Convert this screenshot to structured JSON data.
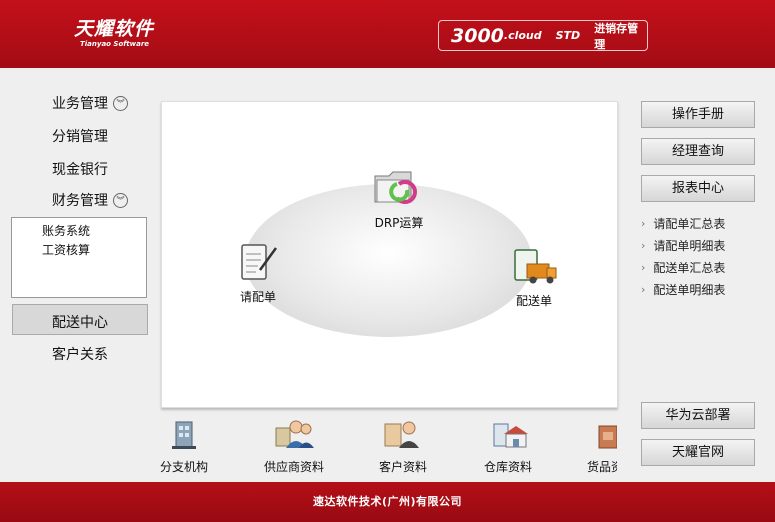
{
  "header": {
    "logo_cn": "天耀软件",
    "logo_en": "Tianyao Software",
    "product_number": "3000",
    "product_cloud": ".cloud",
    "product_edition": "STD",
    "product_name": "进销存管理",
    "bg_color": "#b50f18"
  },
  "nav": {
    "items": [
      {
        "label": "业务管理",
        "icon": "double-chevron-down-icon"
      },
      {
        "label": "分销管理"
      },
      {
        "label": "现金银行"
      },
      {
        "label": "财务管理",
        "icon": "double-chevron-down-icon"
      },
      {
        "label": "配送中心",
        "active": true
      },
      {
        "label": "客户关系"
      }
    ],
    "sub_items": [
      "账务系统",
      "工资核算"
    ]
  },
  "flow": {
    "drp": {
      "label": "DRP运算",
      "icon": "folder-sync-icon"
    },
    "request": {
      "label": "请配单",
      "icon": "clipboard-pen-icon"
    },
    "delivery": {
      "label": "配送单",
      "icon": "delivery-truck-icon"
    }
  },
  "right_panel": {
    "buttons": [
      "操作手册",
      "经理查询",
      "报表中心"
    ],
    "reports": [
      "请配单汇总表",
      "请配单明细表",
      "配送单汇总表",
      "配送单明细表"
    ],
    "bottom_buttons": [
      "华为云部署",
      "天耀官网"
    ]
  },
  "bottom_icons": [
    {
      "label": "分支机构",
      "icon": "building-icon"
    },
    {
      "label": "供应商资料",
      "icon": "supplier-people-icon"
    },
    {
      "label": "客户资料",
      "icon": "customer-person-icon"
    },
    {
      "label": "仓库资料",
      "icon": "warehouse-icon"
    },
    {
      "label": "货品资",
      "icon": "goods-icon"
    }
  ],
  "footer": {
    "text": "速达软件技术(广州)有限公司"
  }
}
